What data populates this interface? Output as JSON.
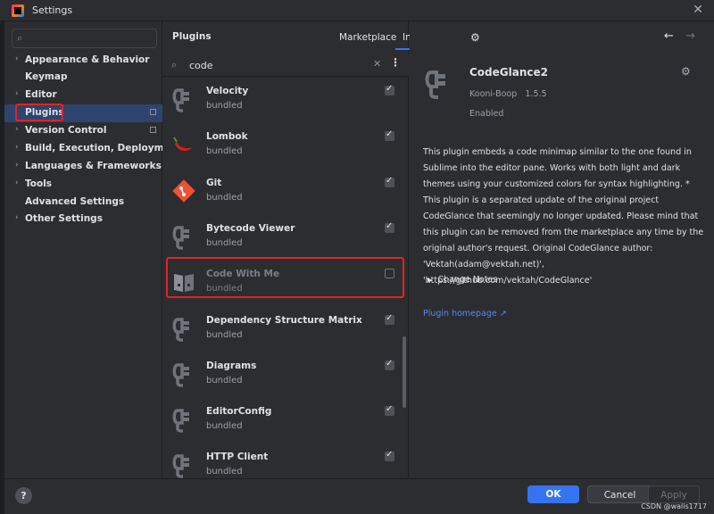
{
  "window": {
    "title": "Settings",
    "close_icon": "close-icon"
  },
  "search": {
    "placeholder": "Q▾",
    "value": ""
  },
  "sidebar": {
    "items": [
      {
        "label": "Appearance & Behavior",
        "expandable": true
      },
      {
        "label": "Keymap",
        "expandable": false
      },
      {
        "label": "Editor",
        "expandable": true
      },
      {
        "label": "Plugins",
        "expandable": false,
        "selected": true
      },
      {
        "label": "Version Control",
        "expandable": true
      },
      {
        "label": "Build, Execution, Deployment",
        "expandable": true
      },
      {
        "label": "Languages & Frameworks",
        "expandable": true
      },
      {
        "label": "Tools",
        "expandable": true
      },
      {
        "label": "Advanced Settings",
        "expandable": false
      },
      {
        "label": "Other Settings",
        "expandable": true
      }
    ]
  },
  "plugins": {
    "title": "Plugins",
    "tabs": [
      {
        "label": "Marketplace"
      },
      {
        "label": "Installed",
        "active": true
      }
    ],
    "search_value": "code",
    "items": [
      {
        "name": "Velocity",
        "sub": "bundled",
        "enabled": true
      },
      {
        "name": "Lombok",
        "sub": "bundled",
        "enabled": true
      },
      {
        "name": "Git",
        "sub": "bundled",
        "enabled": true
      },
      {
        "name": "Bytecode Viewer",
        "sub": "bundled",
        "enabled": true
      },
      {
        "name": "Code With Me",
        "sub": "bundled",
        "enabled": false
      },
      {
        "name": "Dependency Structure Matrix",
        "sub": "bundled",
        "enabled": true
      },
      {
        "name": "Diagrams",
        "sub": "bundled",
        "enabled": true
      },
      {
        "name": "EditorConfig",
        "sub": "bundled",
        "enabled": true
      },
      {
        "name": "HTTP Client",
        "sub": "bundled",
        "enabled": true
      }
    ]
  },
  "details": {
    "name": "CodeGlance2",
    "vendor": "Kooni-Boop",
    "version": "1.5.5",
    "status": "Enabled",
    "description": "This plugin embeds a code minimap similar to the one found in Sublime into the editor pane. Works with both light and dark themes using your customized colors for syntax highlighting. * This plugin is a separated update of the original project CodeGlance that seemingly no longer updated. Please mind that this plugin can be removed from the marketplace any time by the original author's request. Original CodeGlance author: 'Vektah(adam@vektah.net)', 'https://github.com/vektah/CodeGlance'",
    "change_notes": "Change Notes",
    "homepage": "Plugin homepage ↗"
  },
  "buttons": {
    "help": "?",
    "ok": "OK",
    "cancel": "Cancel",
    "apply": "Apply"
  },
  "watermark": "CSDN @walis1717",
  "colors": {
    "accent": "#3574f0",
    "highlight": "#e02424",
    "selected": "#2e436e",
    "background": "#2b2d30"
  }
}
